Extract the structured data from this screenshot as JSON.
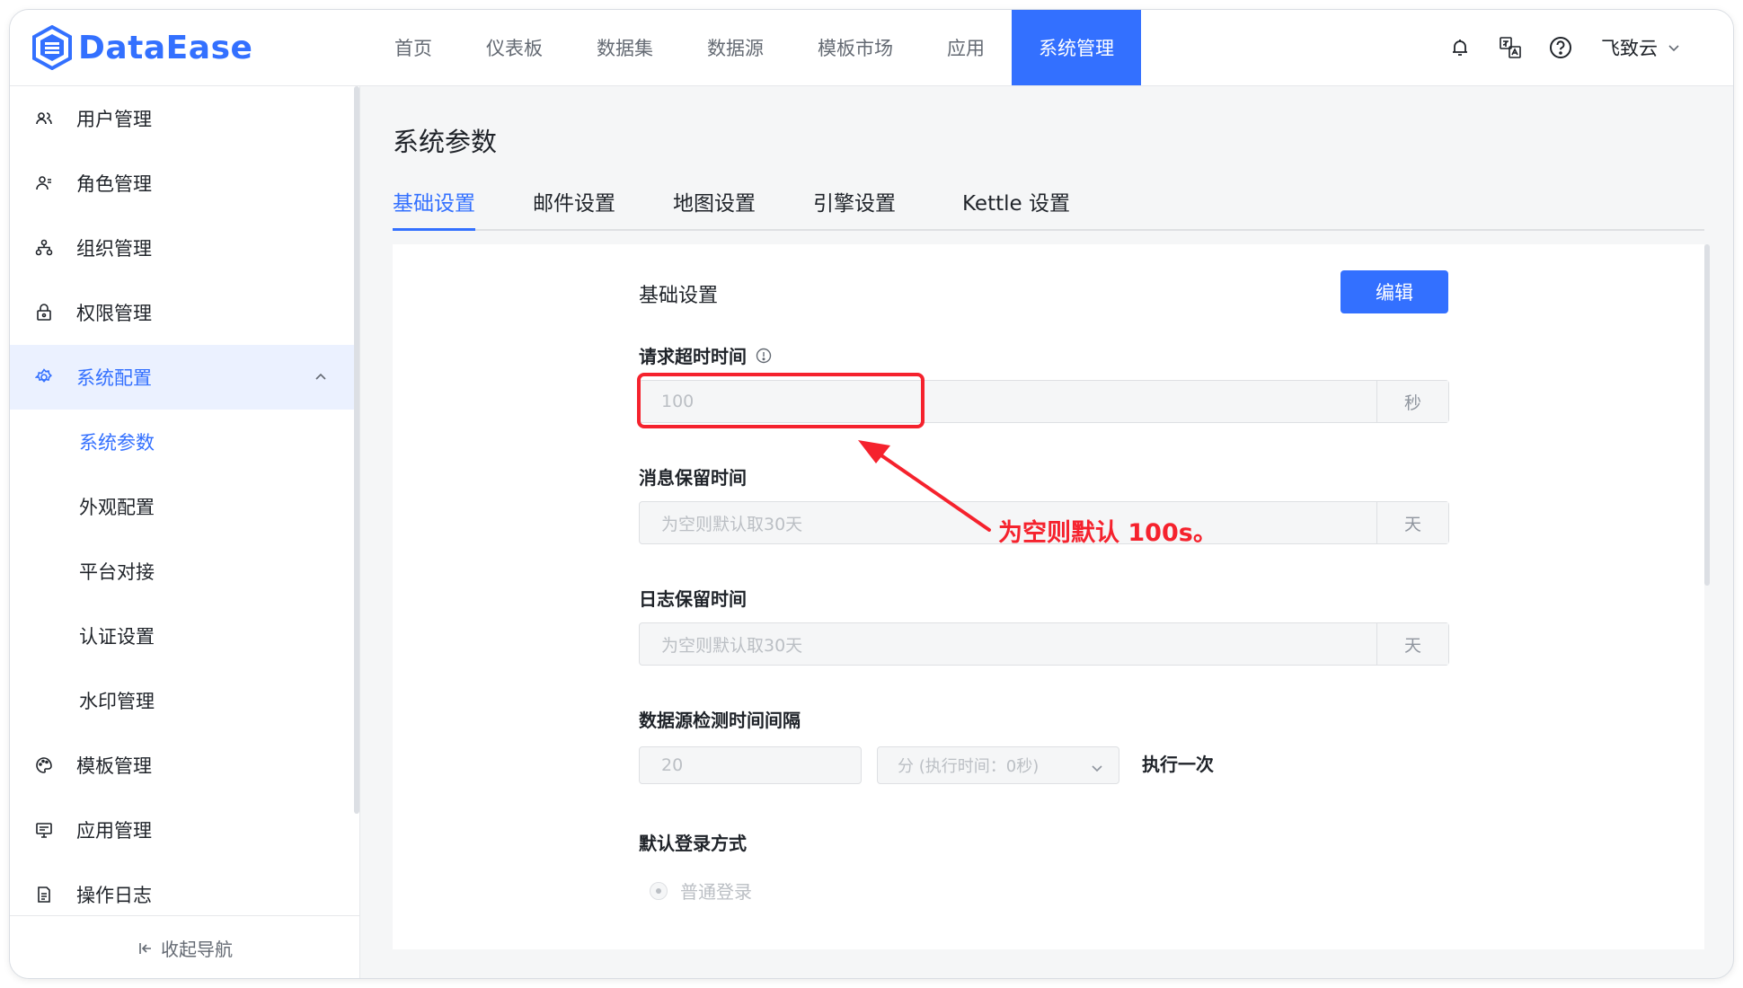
{
  "app": {
    "logo_text": "DataEase",
    "accent": "#3370ff"
  },
  "nav": {
    "items": [
      "首页",
      "仪表板",
      "数据集",
      "数据源",
      "模板市场",
      "应用",
      "系统管理"
    ],
    "active": "系统管理"
  },
  "header": {
    "user_name": "飞致云"
  },
  "sidebar": {
    "items": [
      {
        "label": "用户管理",
        "icon": "users-icon"
      },
      {
        "label": "角色管理",
        "icon": "user-role-icon"
      },
      {
        "label": "组织管理",
        "icon": "org-tree-icon"
      },
      {
        "label": "权限管理",
        "icon": "lock-icon"
      },
      {
        "label": "系统配置",
        "icon": "gear-icon"
      },
      {
        "label": "模板管理",
        "icon": "palette-icon"
      },
      {
        "label": "应用管理",
        "icon": "monitor-icon"
      },
      {
        "label": "操作日志",
        "icon": "document-icon"
      }
    ],
    "sub_items": [
      "系统参数",
      "外观配置",
      "平台对接",
      "认证设置",
      "水印管理"
    ],
    "active_sub": "系统参数",
    "collapse_label": "收起导航"
  },
  "main": {
    "title": "系统参数",
    "tabs": [
      "基础设置",
      "邮件设置",
      "地图设置",
      "引擎设置",
      "Kettle 设置"
    ],
    "active_tab": "基础设置",
    "section_title": "基础设置",
    "edit_label": "编辑",
    "fields": {
      "request_timeout": {
        "label": "请求超时时间",
        "value": "100",
        "unit": "秒"
      },
      "message_retention": {
        "label": "消息保留时间",
        "placeholder": "为空则默认取30天",
        "unit": "天"
      },
      "log_retention": {
        "label": "日志保留时间",
        "placeholder": "为空则默认取30天",
        "unit": "天"
      },
      "ds_check_interval": {
        "label": "数据源检测时间间隔",
        "value": "20",
        "select_value": "分 (执行时间：0秒)",
        "suffix": "执行一次"
      },
      "default_login": {
        "label": "默认登录方式",
        "option": "普通登录"
      }
    }
  },
  "annotation": {
    "text": "为空则默认 100s。",
    "color": "#f5222d"
  }
}
